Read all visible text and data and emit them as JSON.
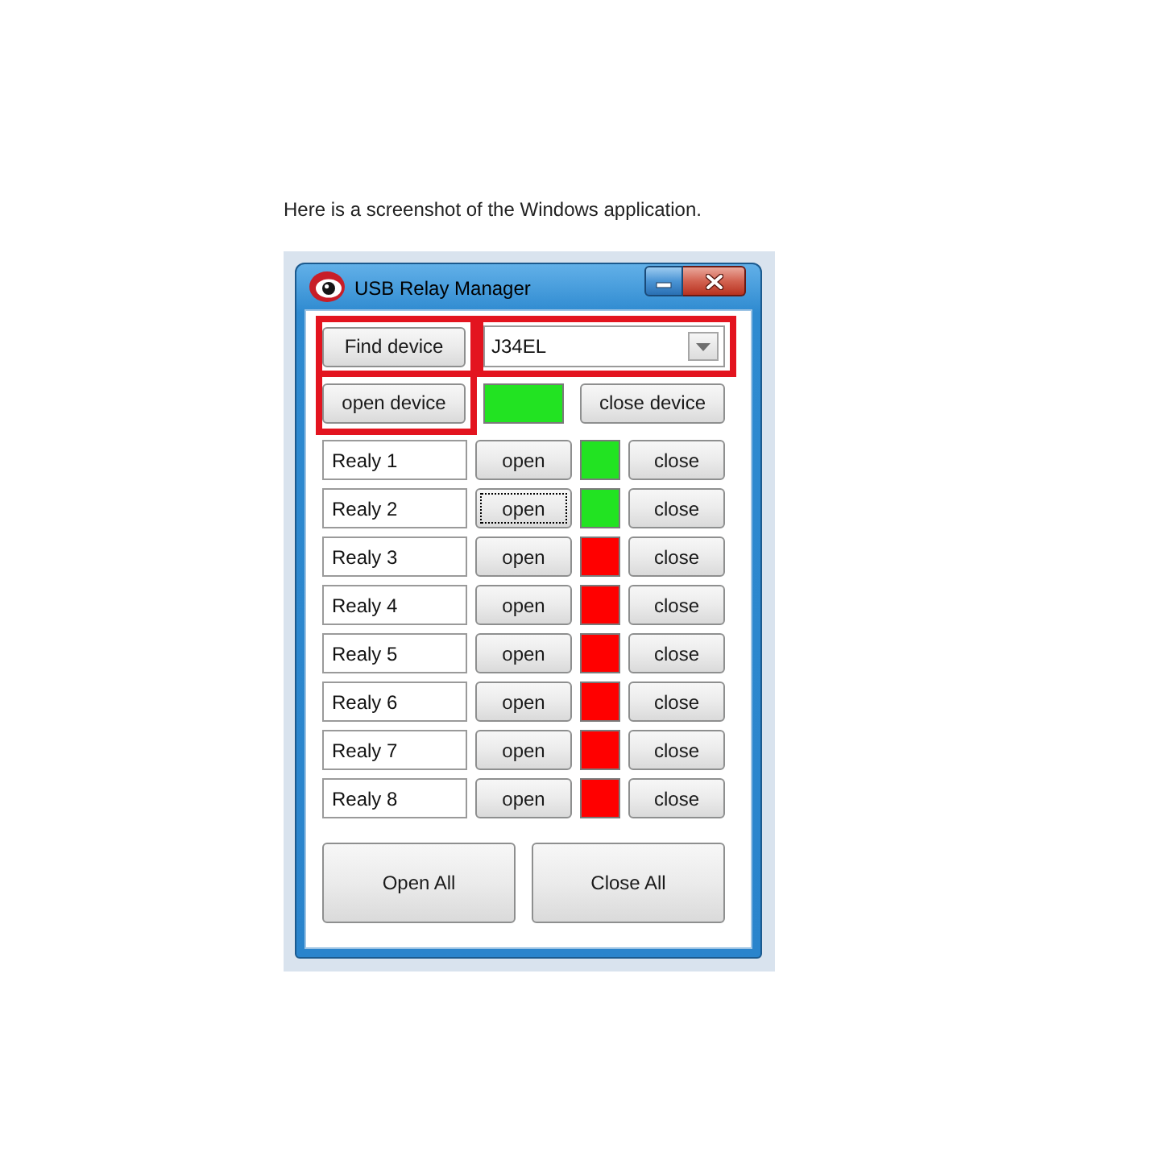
{
  "caption": "Here is a screenshot of the Windows application.",
  "window": {
    "title": "USB Relay Manager"
  },
  "device": {
    "find_button": {
      "label": "Find device",
      "highlighted": true
    },
    "port_dropdown": {
      "value": "J34EL",
      "highlighted": true
    },
    "open_button": {
      "label": "open device",
      "highlighted": true
    },
    "connected": true,
    "close_button": {
      "label": "close device"
    }
  },
  "relays": [
    {
      "name": "Realy 1",
      "on": true,
      "open_button": {
        "label": "open",
        "focused": false
      },
      "close_button": {
        "label": "close"
      }
    },
    {
      "name": "Realy 2",
      "on": true,
      "open_button": {
        "label": "open",
        "focused": true
      },
      "close_button": {
        "label": "close"
      }
    },
    {
      "name": "Realy 3",
      "on": false,
      "open_button": {
        "label": "open",
        "focused": false
      },
      "close_button": {
        "label": "close"
      }
    },
    {
      "name": "Realy 4",
      "on": false,
      "open_button": {
        "label": "open",
        "focused": false
      },
      "close_button": {
        "label": "close"
      }
    },
    {
      "name": "Realy 5",
      "on": false,
      "open_button": {
        "label": "open",
        "focused": false
      },
      "close_button": {
        "label": "close"
      }
    },
    {
      "name": "Realy 6",
      "on": false,
      "open_button": {
        "label": "open",
        "focused": false
      },
      "close_button": {
        "label": "close"
      }
    },
    {
      "name": "Realy 7",
      "on": false,
      "open_button": {
        "label": "open",
        "focused": false
      },
      "close_button": {
        "label": "close"
      }
    },
    {
      "name": "Realy 8",
      "on": false,
      "open_button": {
        "label": "open",
        "focused": false
      },
      "close_button": {
        "label": "close"
      }
    }
  ],
  "bulk_buttons": [
    "Open All",
    "Close All"
  ]
}
